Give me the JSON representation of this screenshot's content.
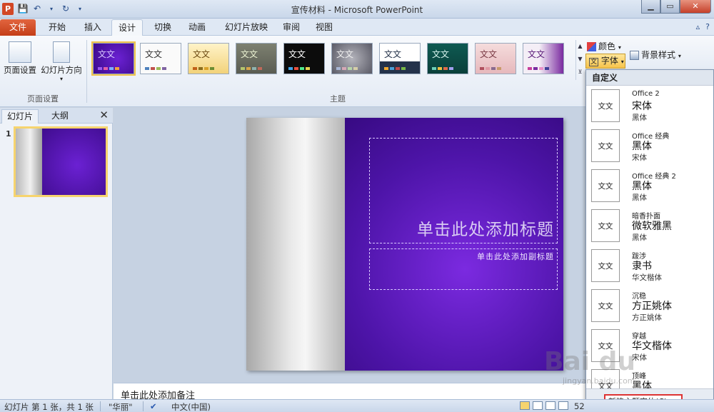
{
  "window": {
    "title": "宣传材料 - Microsoft PowerPoint",
    "app_icon": "P",
    "help": "?"
  },
  "tabs": [
    "文件",
    "开始",
    "插入",
    "设计",
    "切换",
    "动画",
    "幻灯片放映",
    "审阅",
    "视图"
  ],
  "ribbon": {
    "page_setup": "页面设置",
    "slide_orientation": "幻灯片方向",
    "group_page_setup": "页面设置",
    "group_themes": "主题",
    "theme_sample": "文文",
    "colors": "颜色",
    "fonts": "字体",
    "background_styles": "背景样式"
  },
  "fonts_dropdown": {
    "header": "自定义",
    "items": [
      {
        "name": "Office 2",
        "heading": "宋体",
        "body": "黑体"
      },
      {
        "name": "Office 经典",
        "heading": "黑体",
        "body": "宋体"
      },
      {
        "name": "Office 经典 2",
        "heading": "黑体",
        "body": "黑体"
      },
      {
        "name": "暗香扑面",
        "heading": "微软雅黑",
        "body": "黑体"
      },
      {
        "name": "跋涉",
        "heading": "隶书",
        "body": "华文楷体"
      },
      {
        "name": "沉稳",
        "heading": "方正姚体",
        "body": "方正姚体"
      },
      {
        "name": "穿越",
        "heading": "华文楷体",
        "body": "宋体"
      },
      {
        "name": "顶峰",
        "heading": "黑体",
        "body": ""
      }
    ],
    "thumb_text": "文文",
    "new_fonts": "新建主题字体(C)..."
  },
  "left_pane": {
    "tab_slides": "幻灯片",
    "tab_outline": "大纲",
    "slide_number": "1"
  },
  "slide": {
    "title_placeholder": "单击此处添加标题",
    "subtitle_placeholder": "单击此处添加副标题"
  },
  "notes": "单击此处添加备注",
  "status": {
    "slide_info": "幻灯片 第 1 张，共 1 张",
    "theme": "\"华丽\"",
    "language": "中文(中国)",
    "zoom": "52"
  },
  "watermark": {
    "text": "Bai du",
    "url": "jingyan.baidu.com"
  },
  "colors": {
    "accent": "#5a1bb8",
    "file_tab": "#d24726",
    "highlight": "#f6c44c"
  }
}
